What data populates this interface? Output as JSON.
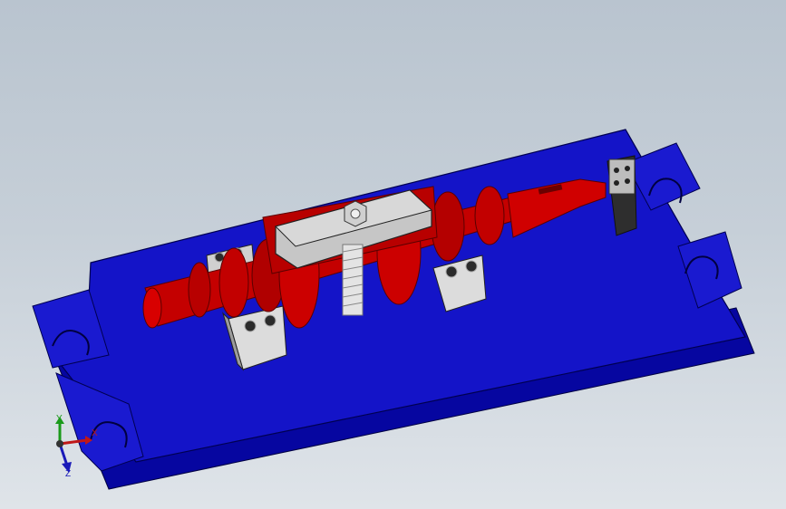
{
  "scene": {
    "background_top": "#b9c4cf",
    "background_bottom": "#dfe4e9",
    "colors": {
      "base_plate_top": "#1010c8",
      "base_plate_side": "#0808a0",
      "base_plate_edge": "#000050",
      "workpiece": "#c80000",
      "workpiece_dark": "#8a0000",
      "support_block": "#d8d8d8",
      "support_block_dark": "#9a9a9a",
      "clamp": "#c8c8c8",
      "screw": "#e0e0e0",
      "bolt_head": "#2a2a2a"
    }
  },
  "triad": {
    "x_label": "X",
    "y_label": "Y",
    "z_label": "Z",
    "x_color": "#c01818",
    "y_color": "#1a9a1a",
    "z_color": "#1a1ab8"
  }
}
